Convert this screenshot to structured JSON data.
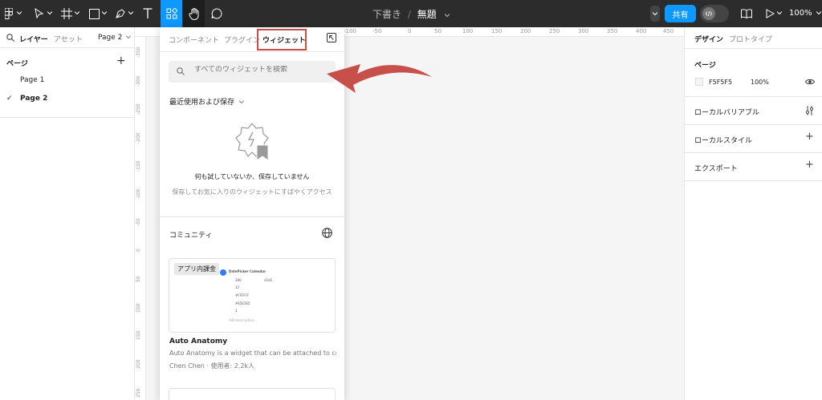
{
  "toolbar": {
    "doc_folder": "下書き",
    "doc_separator": "/",
    "doc_name": "無題",
    "share_label": "共有",
    "zoom": "100%",
    "icons": [
      "figma-menu-icon",
      "move-tool-icon",
      "frame-tool-icon",
      "shape-tool-icon",
      "pen-tool-icon",
      "text-tool-icon",
      "resources-icon",
      "hand-tool-icon",
      "comment-icon",
      "dev-mode-icon",
      "library-icon",
      "present-icon"
    ],
    "active_color": "#0d99ff"
  },
  "left_panel": {
    "tab_layers": "レイヤー",
    "tab_assets": "アセット",
    "page_selector": "Page 2",
    "pages_title": "ページ",
    "pages": [
      "Page 1",
      "Page 2"
    ],
    "current_page_check": "✓",
    "add": "+"
  },
  "rulers": {
    "top": [
      "-100",
      "-50",
      "0",
      "50",
      "100",
      "150",
      "200",
      "250",
      "300",
      "350",
      "400",
      "450"
    ],
    "left": [
      "-350",
      "-300",
      "-250",
      "-200",
      "-150",
      "-100",
      "-50",
      "0",
      "50",
      "100",
      "150",
      "200",
      "250"
    ]
  },
  "widget_panel": {
    "tabs": [
      "コンポーネント",
      "プラグイン",
      "ウィジェット"
    ],
    "search_placeholder": "すべてのウィジェットを検索",
    "recent_title": "最近使用および保存",
    "empty_title": "何も試していないか、保存していません",
    "empty_subtitle": "保存してお気に入りのウィジェットにすばやくアクセス",
    "community_title": "コミュニティ",
    "highlight_color": "#c8504a",
    "card": {
      "badge": "アプリ内課金",
      "preview_title": "DatePicker Calendar",
      "preview_lines": [
        "280",
        "x5x6",
        "12",
        "#FFFFFF",
        "#E5E5E5",
        "1",
        "Add description..."
      ],
      "name": "Auto Anatomy",
      "description": "Auto Anatomy is a widget that can be attached to co...",
      "author": "Chen Chen · 使用者: 2.2k人"
    }
  },
  "right_panel": {
    "tab_design": "デザイン",
    "tab_prototype": "プロトタイプ",
    "page_section": "ページ",
    "page_color": "F5F5F5",
    "page_opacity": "100%",
    "local_variables": "ローカルバリアブル",
    "local_styles": "ローカルスタイル",
    "export": "エクスポート",
    "add": "+"
  }
}
